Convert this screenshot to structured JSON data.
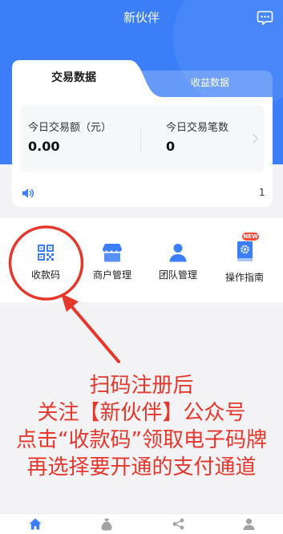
{
  "header": {
    "title": "新伙伴",
    "message_icon": "message-icon"
  },
  "tabs": [
    {
      "label": "交易数据",
      "active": true
    },
    {
      "label": "收益数据",
      "active": false
    }
  ],
  "stats_panel": {
    "chevron_icon": "chevron-right-icon"
  },
  "stats": [
    {
      "label": "今日交易额（元）",
      "value": "0.00"
    },
    {
      "label": "今日交易笔数",
      "value": "0"
    }
  ],
  "notice": {
    "icon": "speaker-icon",
    "text": "1"
  },
  "grid": {
    "items": [
      {
        "label": "收款码",
        "icon": "qr-code-icon"
      },
      {
        "label": "商户管理",
        "icon": "store-icon"
      },
      {
        "label": "团队管理",
        "icon": "team-icon"
      },
      {
        "label": "操作指南",
        "icon": "guide-book-icon",
        "badge": "NEW"
      }
    ]
  },
  "annotation": {
    "lines": [
      "扫码注册后",
      "关注【新伙伴】公众号",
      "点击“收款码”领取电子码牌",
      "再选择要开通的支付通道"
    ]
  },
  "bottom_nav": {
    "active_index": 0,
    "items": [
      {
        "icon": "home-icon"
      },
      {
        "icon": "money-bag-icon"
      },
      {
        "icon": "share-icon"
      },
      {
        "icon": "user-icon"
      }
    ]
  },
  "colors": {
    "primary": "#3b7ef7",
    "annotation": "#e5372c",
    "badge": "#f24b3c",
    "page_background": "#f3f3f5"
  }
}
